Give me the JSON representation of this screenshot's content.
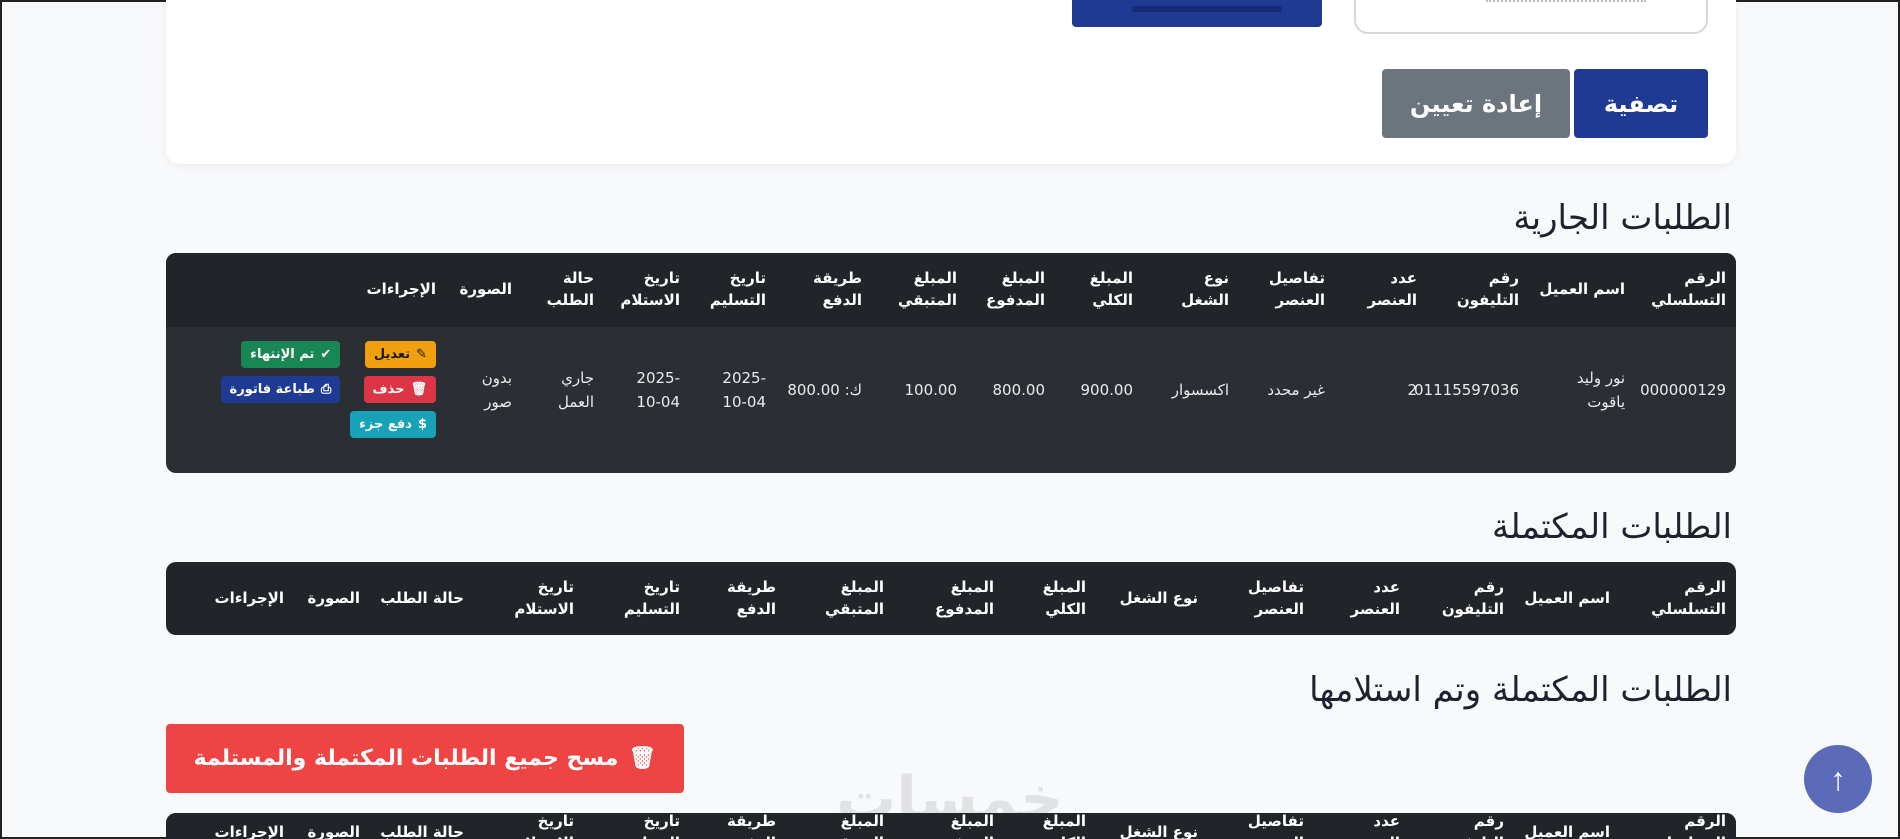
{
  "filter": {
    "filter_label": "تصفية",
    "reset_label": "إعادة تعيين"
  },
  "sections": {
    "current": "الطلبات الجارية",
    "completed": "الطلبات المكتملة",
    "delivered": "الطلبات المكتملة وتم استلامها"
  },
  "columns": [
    "الرقم التسلسلي",
    "اسم العميل",
    "رقم التليفون",
    "عدد العنصر",
    "تفاصيل العنصر",
    "نوع الشغل",
    "المبلغ الكلي",
    "المبلغ المدفوع",
    "المبلغ المتبقي",
    "طريقة الدفع",
    "تاريخ التسليم",
    "تاريخ الاستلام",
    "حالة الطلب",
    "الصورة",
    "الإجراءات"
  ],
  "current_rows": [
    {
      "serial": "000000129",
      "customer": "نور وليد ياقوت",
      "phone": "01115597036",
      "count": "2",
      "details": "غير محدد",
      "work_type": "اكسسوار",
      "total": "900.00",
      "paid": "800.00",
      "remaining": "100.00",
      "payment": "ك: 800.00",
      "delivery_date": "2025-10-04",
      "receive_date": "2025-10-04",
      "status": "جاري العمل",
      "image": "بدون صور"
    }
  ],
  "actions": {
    "edit": "تعديل",
    "done": "تم الإنتهاء",
    "delete": "حذف",
    "print": "طباعة فاتورة",
    "pay": "دفع جزء"
  },
  "clear_all_label": "مسح جميع الطلبات المكتملة والمستلمة",
  "watermark": "خمسات",
  "icons": {
    "edit": "edit-icon",
    "done": "check-circle-icon",
    "delete": "trash-icon",
    "print": "printer-icon",
    "pay": "money-icon",
    "scroll": "arrow-up-icon"
  }
}
